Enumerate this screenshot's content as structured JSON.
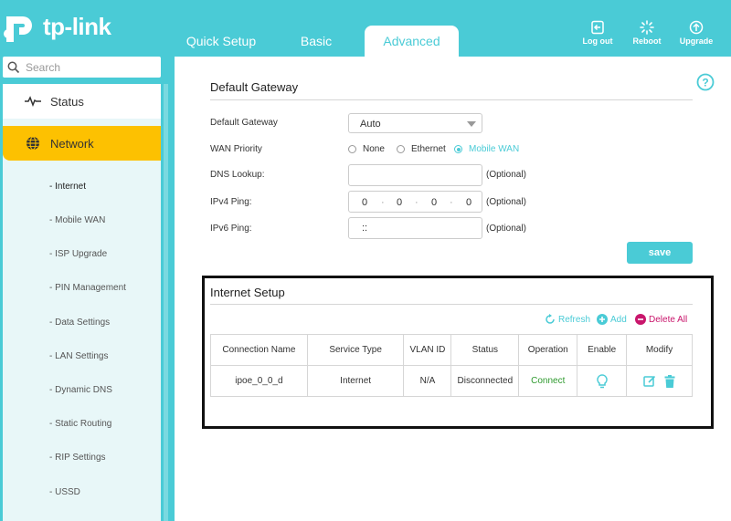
{
  "header": {
    "brand": "tp-link",
    "tabs": [
      {
        "label": "Quick Setup"
      },
      {
        "label": "Basic"
      },
      {
        "label": "Advanced"
      }
    ],
    "buttons": [
      {
        "label": "Log out",
        "icon": "logout-icon"
      },
      {
        "label": "Reboot",
        "icon": "reboot-icon"
      },
      {
        "label": "Upgrade",
        "icon": "upgrade-icon"
      }
    ]
  },
  "sidebar": {
    "search_placeholder": "Search",
    "status_label": "Status",
    "network_label": "Network",
    "submenu": [
      "- Internet",
      "- Mobile WAN",
      "- ISP Upgrade",
      "- PIN Management",
      "- Data Settings",
      "- LAN Settings",
      "- Dynamic DNS",
      "- Static Routing",
      "- RIP Settings",
      "- USSD"
    ]
  },
  "gateway": {
    "title": "Default Gateway",
    "default_gateway_label": "Default Gateway",
    "default_gateway_value": "Auto",
    "wan_priority_label": "WAN Priority",
    "wan_options": [
      "None",
      "Ethernet",
      "Mobile WAN"
    ],
    "wan_selected": "Mobile WAN",
    "dns_label": "DNS Lookup:",
    "dns_value": "",
    "ipv4_label": "IPv4 Ping:",
    "ipv4_octets": [
      "0",
      "0",
      "0",
      "0"
    ],
    "ipv6_label": "IPv6 Ping:",
    "ipv6_value": "::",
    "optional": "(Optional)",
    "save_label": "save"
  },
  "internet_setup": {
    "title": "Internet Setup",
    "refresh_label": "Refresh",
    "add_label": "Add",
    "delete_all_label": "Delete All",
    "columns": [
      "Connection Name",
      "Service Type",
      "VLAN ID",
      "Status",
      "Operation",
      "Enable",
      "Modify"
    ],
    "rows": [
      {
        "name": "ipoe_0_0_d",
        "service": "Internet",
        "vlan": "N/A",
        "status": "Disconnected",
        "operation": "Connect"
      }
    ]
  },
  "colors": {
    "accent": "#4acbd6",
    "network_highlight": "#fdc101",
    "delete": "#c9166c",
    "connect": "#2e9a2e"
  }
}
